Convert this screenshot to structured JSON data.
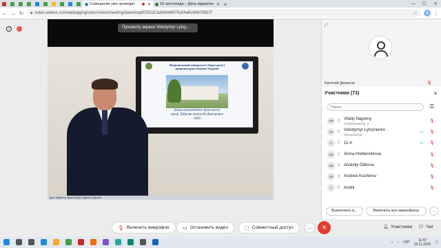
{
  "browser": {
    "tabs": [
      {
        "title": "Совещание уже проводит",
        "active": true,
        "fav_color": "#1a8fb0",
        "recording": true
      },
      {
        "title": "18 листопада – День відкритих",
        "active": false,
        "fav_color": "#2e7d32"
      }
    ],
    "small_tab_colors": [
      "#c0392b",
      "#43a047",
      "#43a047",
      "#43a047",
      "#1e88e5",
      "#43a047",
      "#fbbc04",
      "#43a047",
      "#1e88e5",
      "#43a047"
    ],
    "url": "nules.webex.com/webappng/sites/nules/meeting/download/f252d13a66848979184a6c666008b7f"
  },
  "stage": {
    "share_banner": "Просмотр экрана Volodymyr Lytvy...",
    "slide": {
      "title": "Національний університет біоресурсів і природокористування України",
      "caption": [
        "Декан економічного факультету",
        "проф. Діброва Анатолій Дмитрович",
        "2020"
      ]
    },
    "shared_taskbar_text": "Дань відкритих дверей   Дань відкритих дверей"
  },
  "controls": {
    "mic_label": "Включить микрофон",
    "video_label": "Остановить видео",
    "share_label": "Совместный доступ",
    "more_label": "...",
    "participants_label": "Участники",
    "chat_label": "Чат"
  },
  "panel": {
    "self_name": "Евгений Денисов",
    "participants_title": "Участники (73)",
    "search_placeholder": "Поиск",
    "participants": [
      {
        "initials": "VN",
        "name": "Vitaliy Nagorny",
        "role": "Соорганизатор, я",
        "camera": false
      },
      {
        "initials": "VL",
        "name": "Volodymyr Lytvynenko",
        "role": "Организатор",
        "camera": true
      },
      {
        "initials": "1",
        "name": "11-A",
        "role": "",
        "camera": true
      },
      {
        "initials": "AH",
        "name": "Alona Hrebennikova",
        "role": "",
        "camera": false
      },
      {
        "initials": "AD",
        "name": "Anatoliy Dibrova",
        "role": "",
        "camera": false
      },
      {
        "initials": "AK",
        "name": "Andrew Kucherov",
        "role": "",
        "camera": false
      },
      {
        "initials": "A",
        "name": "Andrii",
        "role": "",
        "camera": false
      }
    ],
    "mute_label": "Выключить в...",
    "mute_all_label": "Включить все микрофоны",
    "footer_more": "..."
  },
  "taskbar": {
    "icons": [
      {
        "name": "windows-start-icon",
        "color": "#1e88e5"
      },
      {
        "name": "search-icon",
        "color": "#555555"
      },
      {
        "name": "task-view-icon",
        "color": "#555555"
      },
      {
        "name": "edge-icon",
        "color": "#1e88e5"
      },
      {
        "name": "explorer-icon",
        "color": "#f9a825"
      },
      {
        "name": "chrome-icon",
        "color": "#43a047"
      },
      {
        "name": "opera-icon",
        "color": "#c62828"
      },
      {
        "name": "firefox-icon",
        "color": "#ef6c00"
      },
      {
        "name": "app-icon",
        "color": "#7e57c2"
      },
      {
        "name": "app-icon",
        "color": "#26a69a"
      },
      {
        "name": "webex-icon",
        "color": "#00897b"
      },
      {
        "name": "app-icon",
        "color": "#555555"
      },
      {
        "name": "word-icon",
        "color": "#1565c0"
      }
    ],
    "lang": "УКР",
    "time": "11:47",
    "date": "18.11.2020"
  }
}
